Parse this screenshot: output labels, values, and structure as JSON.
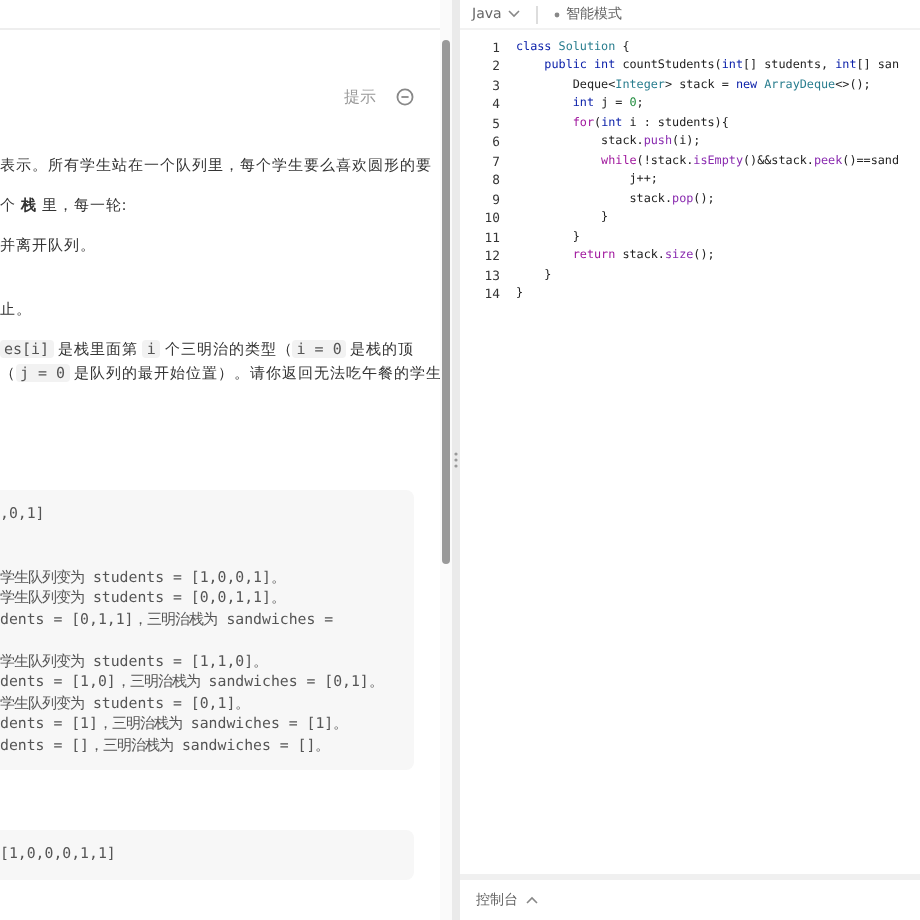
{
  "description": {
    "hint_label": "提示",
    "paragraphs": [
      {
        "kind": "text",
        "text": "表示。所有学生站在一个队列里，每个学生要么喜欢圆形的要"
      },
      {
        "kind": "text",
        "text": "个 **栈** 里，每一轮:"
      },
      {
        "kind": "text",
        "text": "并离开队列。"
      },
      {
        "kind": "gap"
      },
      {
        "kind": "text",
        "text": "止。"
      },
      {
        "kind": "mixed",
        "parts": [
          {
            "kind": "code",
            "text": "es[i]"
          },
          {
            "kind": "text",
            "text": " 是栈里面第 "
          },
          {
            "kind": "code",
            "text": "i"
          },
          {
            "kind": "text",
            "text": " 个三明治的类型（"
          },
          {
            "kind": "code",
            "text": "i = 0"
          },
          {
            "kind": "text",
            "text": " 是栈的顶"
          }
        ]
      },
      {
        "kind": "mixed",
        "parts": [
          {
            "kind": "text",
            "text": "（"
          },
          {
            "kind": "code",
            "text": "j = 0"
          },
          {
            "kind": "text",
            "text": " 是队列的最开始位置）。请你返回无法吃午餐的学生"
          }
        ]
      }
    ],
    "examples": [
      {
        "lines": [
          {
            "kind": "text",
            "text": ",0,1]"
          },
          {
            "kind": "blank"
          },
          {
            "kind": "blank"
          },
          {
            "kind": "text",
            "text": "学生队列变为 students = [1,0,0,1]。"
          },
          {
            "kind": "text",
            "text": "学生队列变为 students = [0,0,1,1]。"
          },
          {
            "kind": "text",
            "text": "dents = [0,1,1]，三明治栈为 sandwiches ="
          },
          {
            "kind": "blank"
          },
          {
            "kind": "text",
            "text": "学生队列变为 students = [1,1,0]。"
          },
          {
            "kind": "text",
            "text": "dents = [1,0]，三明治栈为 sandwiches = [0,1]。"
          },
          {
            "kind": "text",
            "text": "学生队列变为 students = [0,1]。"
          },
          {
            "kind": "text",
            "text": "dents = [1]，三明治栈为 sandwiches = [1]。"
          },
          {
            "kind": "text",
            "text": "dents = []，三明治栈为 sandwiches = []。"
          }
        ]
      },
      {
        "lines": [
          {
            "kind": "text",
            "text": "[1,0,0,0,1,1]"
          }
        ]
      }
    ]
  },
  "editor": {
    "language": "Java",
    "mode": "智能模式",
    "lines": [
      {
        "number": "1",
        "tokens": [
          {
            "kind": "kw",
            "text": "class "
          },
          {
            "kind": "type",
            "text": "Solution "
          },
          {
            "kind": "plain",
            "text": "{"
          }
        ]
      },
      {
        "number": "2",
        "tokens": [
          {
            "kind": "kw",
            "text": "    public int "
          },
          {
            "kind": "plain",
            "text": "countStudents("
          },
          {
            "kind": "kw",
            "text": "int"
          },
          {
            "kind": "plain",
            "text": "[] students, "
          },
          {
            "kind": "kw",
            "text": "int"
          },
          {
            "kind": "plain",
            "text": "[] san"
          }
        ]
      },
      {
        "number": "3",
        "tokens": [
          {
            "kind": "plain",
            "text": "        Deque<"
          },
          {
            "kind": "type",
            "text": "Integer"
          },
          {
            "kind": "plain",
            "text": "> stack = "
          },
          {
            "kind": "kw",
            "text": "new "
          },
          {
            "kind": "type",
            "text": "ArrayDeque"
          },
          {
            "kind": "plain",
            "text": "<>();"
          }
        ]
      },
      {
        "number": "4",
        "tokens": [
          {
            "kind": "kw",
            "text": "        int "
          },
          {
            "kind": "plain",
            "text": "j = "
          },
          {
            "kind": "num",
            "text": "0"
          },
          {
            "kind": "plain",
            "text": ";"
          }
        ]
      },
      {
        "number": "5",
        "tokens": [
          {
            "kind": "ctl",
            "text": "        for"
          },
          {
            "kind": "plain",
            "text": "("
          },
          {
            "kind": "kw",
            "text": "int "
          },
          {
            "kind": "plain",
            "text": "i : students){"
          }
        ]
      },
      {
        "number": "6",
        "tokens": [
          {
            "kind": "plain",
            "text": "            stack."
          },
          {
            "kind": "fn",
            "text": "push"
          },
          {
            "kind": "plain",
            "text": "(i);"
          }
        ]
      },
      {
        "number": "7",
        "tokens": [
          {
            "kind": "ctl",
            "text": "            while"
          },
          {
            "kind": "plain",
            "text": "(!stack."
          },
          {
            "kind": "fn",
            "text": "isEmpty"
          },
          {
            "kind": "plain",
            "text": "()&&stack."
          },
          {
            "kind": "fn",
            "text": "peek"
          },
          {
            "kind": "plain",
            "text": "()==sand"
          }
        ]
      },
      {
        "number": "8",
        "tokens": [
          {
            "kind": "plain",
            "text": "                j++;"
          }
        ]
      },
      {
        "number": "9",
        "tokens": [
          {
            "kind": "plain",
            "text": "                stack."
          },
          {
            "kind": "fn",
            "text": "pop"
          },
          {
            "kind": "plain",
            "text": "();"
          }
        ]
      },
      {
        "number": "10",
        "tokens": [
          {
            "kind": "plain",
            "text": "            }"
          }
        ]
      },
      {
        "number": "11",
        "tokens": [
          {
            "kind": "plain",
            "text": "        }"
          }
        ]
      },
      {
        "number": "12",
        "tokens": [
          {
            "kind": "ctl",
            "text": "        return "
          },
          {
            "kind": "plain",
            "text": "stack."
          },
          {
            "kind": "fn",
            "text": "size"
          },
          {
            "kind": "plain",
            "text": "();"
          }
        ]
      },
      {
        "number": "13",
        "tokens": [
          {
            "kind": "plain",
            "text": "    }"
          }
        ]
      },
      {
        "number": "14",
        "tokens": [
          {
            "kind": "plain",
            "text": "}"
          }
        ]
      }
    ]
  },
  "console": {
    "label": "控制台"
  }
}
